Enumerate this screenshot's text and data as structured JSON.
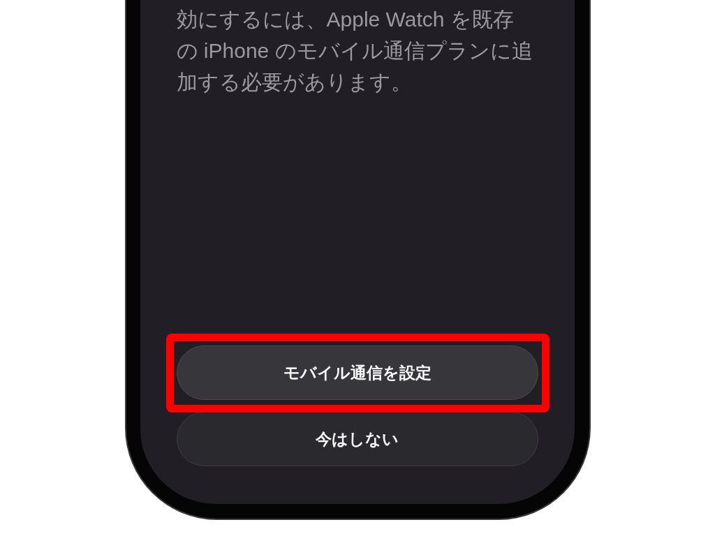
{
  "message": {
    "lines": [
      "効にするには、Apple Watch を既存",
      "の iPhone のモバイル通信プランに追",
      "加する必要があります。"
    ]
  },
  "buttons": [
    {
      "label": "モバイル通信を設定",
      "kind": "primary",
      "highlighted": true
    },
    {
      "label": "今はしない",
      "kind": "secondary",
      "highlighted": false
    }
  ]
}
